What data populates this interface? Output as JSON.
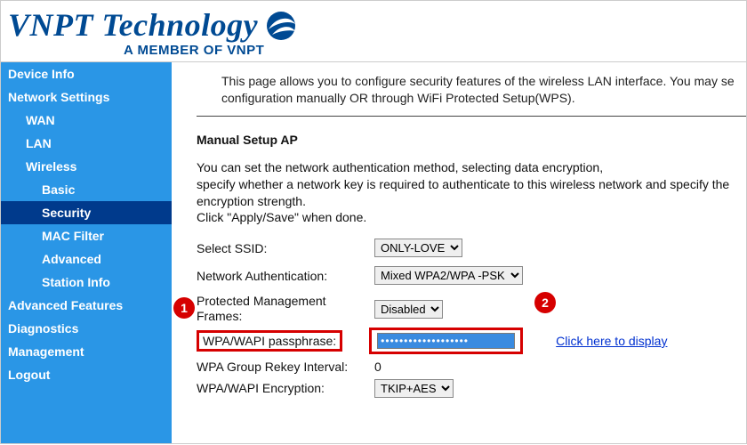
{
  "header": {
    "brand": "VNPT Technology",
    "tagline": "A MEMBER OF VNPT"
  },
  "sidebar": {
    "items": [
      {
        "label": "Device Info",
        "lvl": 1,
        "active": false
      },
      {
        "label": "Network Settings",
        "lvl": 1,
        "active": false
      },
      {
        "label": "WAN",
        "lvl": 2,
        "active": false
      },
      {
        "label": "LAN",
        "lvl": 2,
        "active": false
      },
      {
        "label": "Wireless",
        "lvl": 2,
        "active": false
      },
      {
        "label": "Basic",
        "lvl": 3,
        "active": false
      },
      {
        "label": "Security",
        "lvl": 3,
        "active": true
      },
      {
        "label": "MAC Filter",
        "lvl": 3,
        "active": false
      },
      {
        "label": "Advanced",
        "lvl": 3,
        "active": false
      },
      {
        "label": "Station Info",
        "lvl": 3,
        "active": false
      },
      {
        "label": "Advanced Features",
        "lvl": 1,
        "active": false
      },
      {
        "label": "Diagnostics",
        "lvl": 1,
        "active": false
      },
      {
        "label": "Management",
        "lvl": 1,
        "active": false
      },
      {
        "label": "Logout",
        "lvl": 1,
        "active": false
      }
    ]
  },
  "content": {
    "intro1": "This page allows you to configure security features of the wireless LAN interface. You may se",
    "intro2": "configuration manually OR through WiFi Protected Setup(WPS).",
    "section_title": "Manual Setup AP",
    "p1": "You can set the network authentication method, selecting data encryption,",
    "p2": "specify whether a network key is required to authenticate to this wireless network and specify the",
    "p3": "encryption strength.",
    "p4": "Click \"Apply/Save\" when done.",
    "fields": {
      "ssid_label": "Select SSID:",
      "ssid_value": "ONLY-LOVE",
      "auth_label": "Network Authentication:",
      "auth_value": "Mixed WPA2/WPA -PSK",
      "pmf_label": "Protected Management Frames:",
      "pmf_value": "Disabled",
      "pass_label": "WPA/WAPI passphrase:",
      "pass_value": "•••••••••••••••••••",
      "display_link": "Click here to display",
      "rekey_label": "WPA Group Rekey Interval:",
      "rekey_value": "0",
      "enc_label": "WPA/WAPI Encryption:",
      "enc_value": "TKIP+AES"
    }
  },
  "markers": {
    "m1": "1",
    "m2": "2"
  }
}
